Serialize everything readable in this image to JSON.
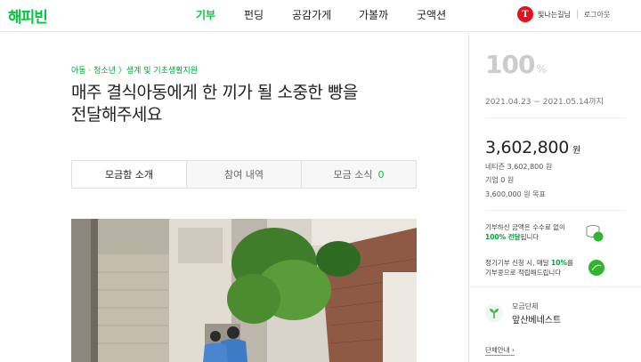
{
  "header": {
    "logo": "해피빈",
    "nav": [
      "기부",
      "펀딩",
      "공감가게",
      "가볼까",
      "굿액션"
    ],
    "avatar_letter": "T",
    "user_name": "빛나는길님",
    "logout": "로그아웃"
  },
  "campaign": {
    "category": "아동 · 청소년 〉생계 및 기초생활지원",
    "title_line1": "매주 결식아동에게 한 끼가 될 소중한 빵을",
    "title_line2": "전달해주세요"
  },
  "tabs": [
    {
      "label": "모금함 소개"
    },
    {
      "label": "참여 내역"
    },
    {
      "label": "모금 소식",
      "count": "0"
    }
  ],
  "side": {
    "percent": "100",
    "percent_sign": "%",
    "period": "2021.04.23 ~ 2021.05.14",
    "period_suffix": "까지",
    "amount": "3,602,800",
    "amount_unit": "원",
    "netizen": "네티즌 3,602,800 원",
    "company": "기업 0 원",
    "goal": "3,600,000 원 목표",
    "info1_a": "기부하신 금액은 수수료 없이",
    "info1_b_bold": "100% 전달",
    "info1_b_rest": "됩니다",
    "info2_a_pre": "정기기부 신청 시, 매달 ",
    "info2_a_bold": "10%",
    "info2_a_post": "를",
    "info2_b": "기부콩으로 적립해드립니다",
    "org_label": "모금단체",
    "org_name": "앞산베네스트",
    "org_link": "단체안내 ›"
  }
}
